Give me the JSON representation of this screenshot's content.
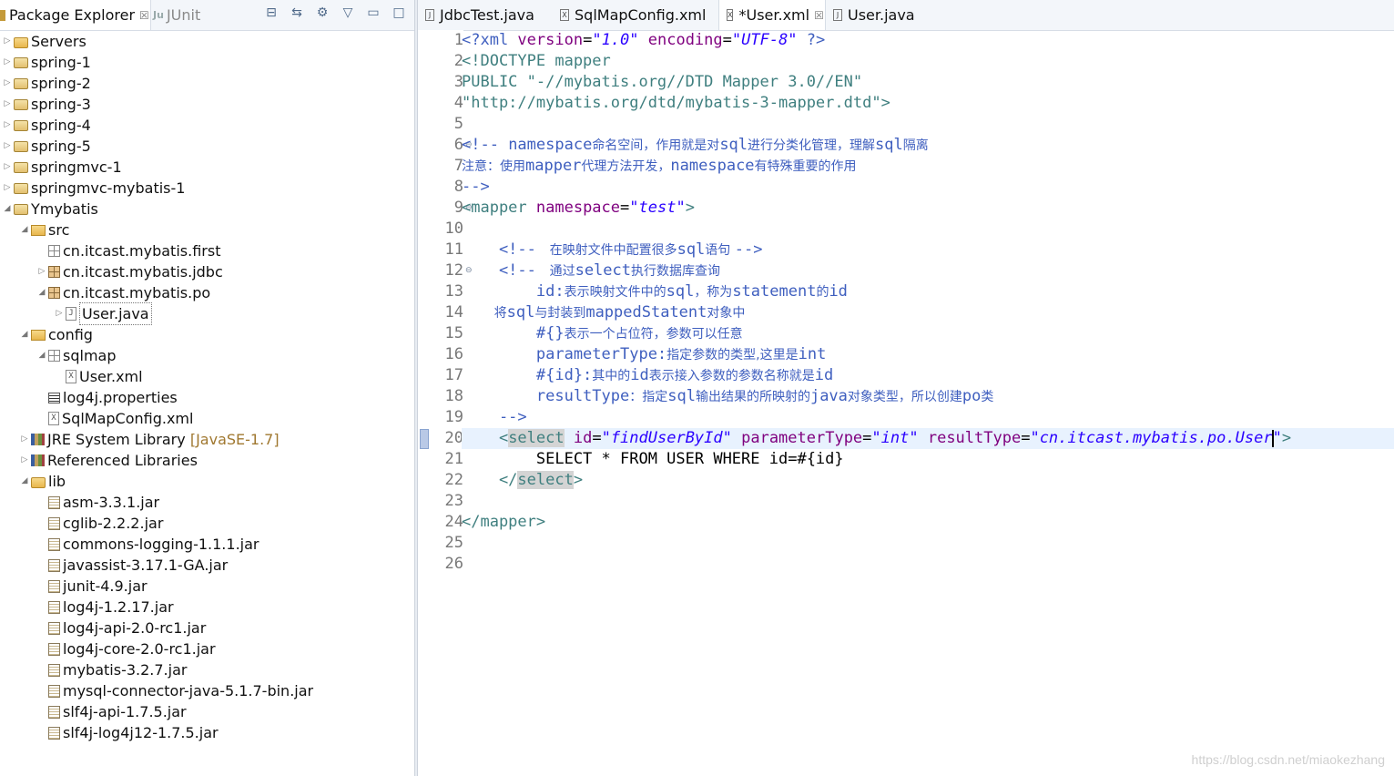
{
  "left_panel": {
    "tabs": [
      {
        "label": "Package Explorer"
      },
      {
        "label": "JUnit"
      }
    ],
    "tree": [
      {
        "label": "Servers"
      },
      {
        "label": "spring-1"
      },
      {
        "label": "spring-2"
      },
      {
        "label": "spring-3"
      },
      {
        "label": "spring-4"
      },
      {
        "label": "spring-5"
      },
      {
        "label": "springmvc-1"
      },
      {
        "label": "springmvc-mybatis-1"
      },
      {
        "label": "Ymybatis"
      },
      {
        "label": "src"
      },
      {
        "label": "cn.itcast.mybatis.first"
      },
      {
        "label": "cn.itcast.mybatis.jdbc"
      },
      {
        "label": "cn.itcast.mybatis.po"
      },
      {
        "label": "User.java"
      },
      {
        "label": "config"
      },
      {
        "label": "sqlmap"
      },
      {
        "label": "User.xml"
      },
      {
        "label": "log4j.properties"
      },
      {
        "label": "SqlMapConfig.xml"
      },
      {
        "label": "JRE System Library",
        "extra": "[JavaSE-1.7]"
      },
      {
        "label": "Referenced Libraries"
      },
      {
        "label": "lib"
      },
      {
        "label": "asm-3.3.1.jar"
      },
      {
        "label": "cglib-2.2.2.jar"
      },
      {
        "label": "commons-logging-1.1.1.jar"
      },
      {
        "label": "javassist-3.17.1-GA.jar"
      },
      {
        "label": "junit-4.9.jar"
      },
      {
        "label": "log4j-1.2.17.jar"
      },
      {
        "label": "log4j-api-2.0-rc1.jar"
      },
      {
        "label": "log4j-core-2.0-rc1.jar"
      },
      {
        "label": "mybatis-3.2.7.jar"
      },
      {
        "label": "mysql-connector-java-5.1.7-bin.jar"
      },
      {
        "label": "slf4j-api-1.7.5.jar"
      },
      {
        "label": "slf4j-log4j12-1.7.5.jar"
      }
    ]
  },
  "editor": {
    "tabs": [
      {
        "label": "JdbcTest.java"
      },
      {
        "label": "SqlMapConfig.xml"
      },
      {
        "label": "*User.xml"
      },
      {
        "label": "User.java"
      }
    ],
    "line_numbers": [
      "1",
      "2",
      "3",
      "4",
      "5",
      "6",
      "7",
      "8",
      "9",
      "10",
      "11",
      "12",
      "13",
      "14",
      "15",
      "16",
      "17",
      "18",
      "19",
      "20",
      "21",
      "22",
      "23",
      "24",
      "25",
      "26"
    ],
    "code": {
      "l1": {
        "a": "<?xml ",
        "b": "version",
        "c": "=",
        "d": "\"1.0\"",
        "e": " encoding",
        "f": "=",
        "g": "\"UTF-8\"",
        "h": " ?>"
      },
      "l2": "<!DOCTYPE mapper",
      "l3": "PUBLIC \"-//mybatis.org//DTD Mapper 3.0//EN\"",
      "l4": "\"http://mybatis.org/dtd/mybatis-3-mapper.dtd\">",
      "l6": {
        "a": "<!-- ",
        "b": "namespace",
        "c": "命名空间，作用就是对",
        "d": "sql",
        "e": "进行分类化管理，理解",
        "f": "sql",
        "g": "隔离"
      },
      "l7": {
        "a": "注意：使用",
        "b": "mapper",
        "c": "代理方法开发，",
        "d": "namespace",
        "e": "有特殊重要的作用"
      },
      "l8": "-->",
      "l9": {
        "a": "<mapper ",
        "b": "namespace",
        "c": "=",
        "d": "\"test\"",
        "e": ">"
      },
      "l11": {
        "a": "    <!-- ",
        "b": " 在映射文件中配置很多",
        "c": "sql",
        "d": "语句 ",
        "e": "-->"
      },
      "l12": {
        "a": "    <!-- ",
        "b": " 通过",
        "c": "select",
        "d": "执行数据库查询"
      },
      "l13": {
        "a": "        id:",
        "b": "表示映射文件中的",
        "c": "sql",
        "d": "，称为",
        "e": "statement",
        "f": "的",
        "g": "id"
      },
      "l14": {
        "a": "        将",
        "b": "sql",
        "c": "与封装到",
        "d": "mappedStatent",
        "e": "对象中"
      },
      "l15": {
        "a": "        #{}",
        "b": "表示一个占位符，参数可以任意"
      },
      "l16": {
        "a": "        parameterType:",
        "b": "指定参数的类型,这里是",
        "c": "int"
      },
      "l17": {
        "a": "        #{id}:",
        "b": "其中的",
        "c": "id",
        "d": "表示接入参数的参数名称就是",
        "e": "id"
      },
      "l18": {
        "a": "        resultType",
        "b": "：指定",
        "c": "sql",
        "d": "输出结果的所映射的",
        "e": "java",
        "f": "对象类型，所以创建",
        "g": "po",
        "h": "类"
      },
      "l19": "    -->",
      "l20": {
        "a": "    <",
        "b": "select",
        "c": " id",
        "d": "=",
        "e": "\"findUserById\"",
        "f": " parameterType",
        "g": "=",
        "h": "\"int\"",
        "i": " resultType",
        "j": "=",
        "k1": "\"cn.itcast.mybatis.po.User",
        "k2": "\"",
        "l": ">"
      },
      "l21": "        SELECT * FROM USER WHERE id=#{id}",
      "l22": {
        "a": "    </",
        "b": "select",
        "c": ">"
      },
      "l24": "</mapper>"
    }
  },
  "watermark": "https://blog.csdn.net/miaokezhang"
}
